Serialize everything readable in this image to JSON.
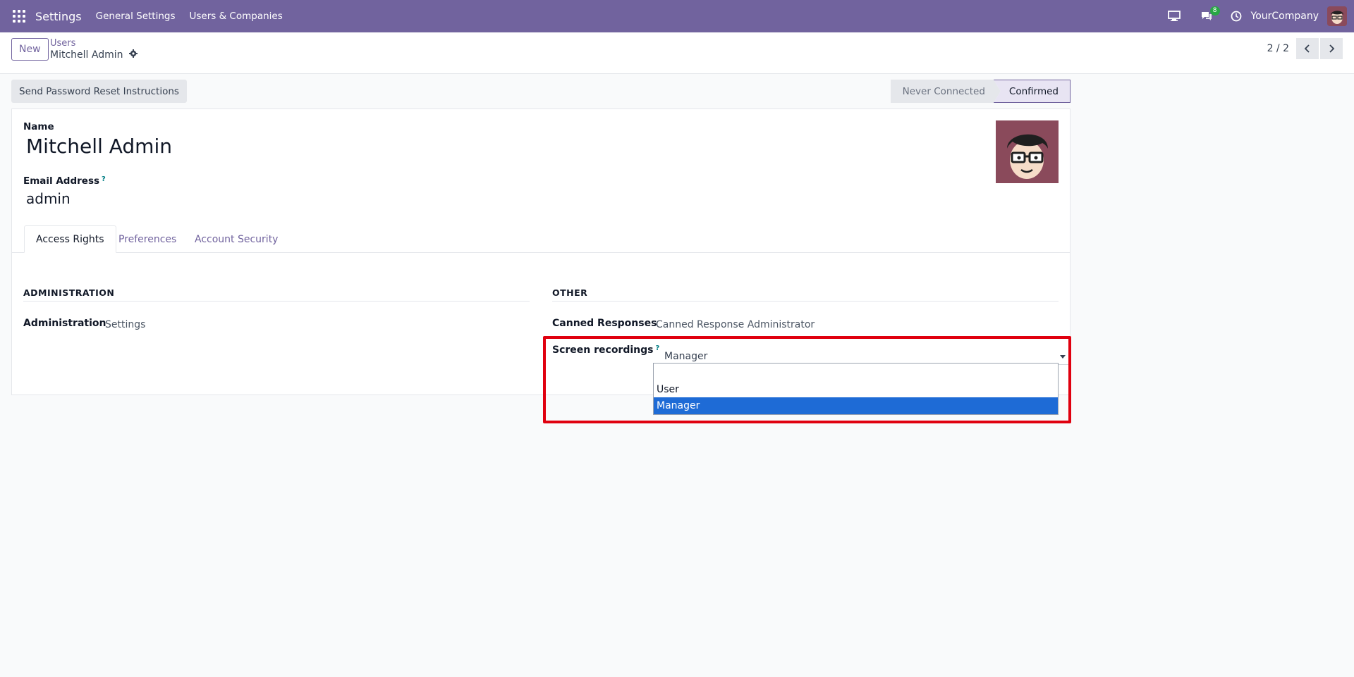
{
  "navbar": {
    "app_name": "Settings",
    "menus": [
      "General Settings",
      "Users & Companies"
    ],
    "chat_badge": "8",
    "company": "YourCompany"
  },
  "control_panel": {
    "new_label": "New",
    "breadcrumb_parent": "Users",
    "breadcrumb_current": "Mitchell Admin",
    "pager": "2 / 2"
  },
  "status_bar": {
    "reset_button": "Send Password Reset Instructions",
    "stages": [
      "Never Connected",
      "Confirmed"
    ],
    "active_stage": "Confirmed"
  },
  "form": {
    "name_label": "Name",
    "name_value": "Mitchell Admin",
    "email_label": "Email Address",
    "email_tooltip": "?",
    "email_value": "admin",
    "tabs": [
      "Access Rights",
      "Preferences",
      "Account Security"
    ],
    "active_tab": "Access Rights",
    "sections": {
      "administration": {
        "title": "ADMINISTRATION",
        "label": "Administration",
        "value": "Settings"
      },
      "other": {
        "title": "OTHER",
        "canned_label": "Canned Responses",
        "canned_value": "Canned Response Administrator",
        "screen_label": "Screen recordings",
        "screen_tooltip": "?",
        "screen_value": "Manager",
        "options": [
          "",
          "User",
          "Manager"
        ],
        "selected_option": "Manager"
      }
    }
  },
  "colors": {
    "navbar": "#71639e",
    "accent": "#71639e",
    "selection": "#1e6bd6",
    "highlight": "#e0000f"
  }
}
